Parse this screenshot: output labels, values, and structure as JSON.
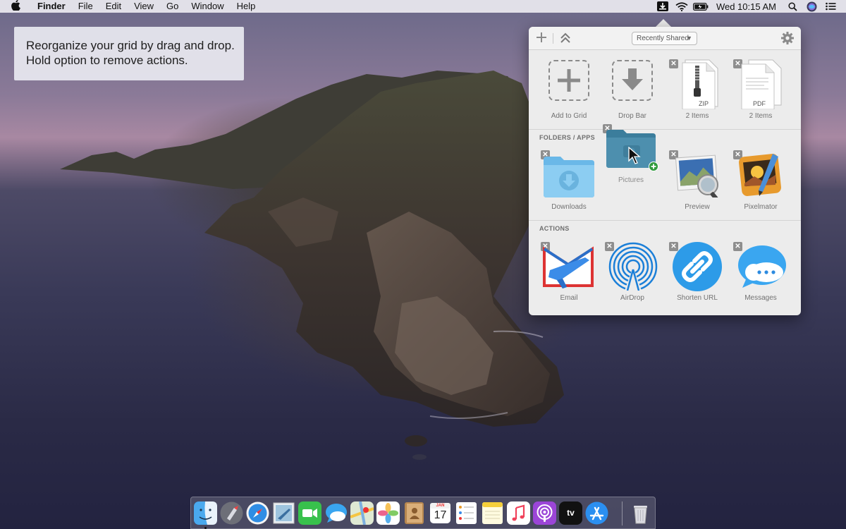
{
  "menubar": {
    "app_name": "Finder",
    "menus": [
      "File",
      "Edit",
      "View",
      "Go",
      "Window",
      "Help"
    ],
    "clock": "Wed 10:15 AM",
    "status_icons": [
      "dropzone-icon",
      "wifi-icon",
      "battery-icon",
      "search-icon",
      "siri-icon",
      "control-center-icon"
    ]
  },
  "callout": {
    "line1": "Reorganize your grid by drag and drop.",
    "line2": "Hold option to remove actions."
  },
  "panel": {
    "toolbar": {
      "filter_value": "Recently Shared",
      "icons": [
        "add-icon",
        "collapse-icon",
        "gear-icon"
      ]
    },
    "top_row": [
      {
        "label": "Add to Grid",
        "icon": "add-icon"
      },
      {
        "label": "Drop Bar",
        "icon": "download-arrow-icon"
      },
      {
        "label": "2 Items",
        "icon": "zip-file-icon",
        "badge": "ZIP"
      },
      {
        "label": "2 Items",
        "icon": "pdf-file-icon",
        "badge": "PDF"
      }
    ],
    "folders_section": {
      "title": "FOLDERS / APPS",
      "items": [
        {
          "label": "Downloads",
          "icon": "downloads-folder-icon"
        },
        {
          "label": "Pictures",
          "icon": "pictures-folder-icon"
        },
        {
          "label": "Preview",
          "icon": "preview-app-icon"
        },
        {
          "label": "Pixelmator",
          "icon": "pixelmator-app-icon"
        }
      ]
    },
    "actions_section": {
      "title": "ACTIONS",
      "items": [
        {
          "label": "Email",
          "icon": "email-icon"
        },
        {
          "label": "AirDrop",
          "icon": "airdrop-icon"
        },
        {
          "label": "Shorten URL",
          "icon": "link-icon"
        },
        {
          "label": "Messages",
          "icon": "messages-icon"
        }
      ]
    }
  },
  "dock": {
    "apps": [
      "Finder",
      "Launchpad",
      "Safari",
      "Mail",
      "FaceTime",
      "Messages",
      "Maps",
      "Photos",
      "Contacts",
      "Calendar",
      "Reminders",
      "Notes",
      "Music",
      "Podcasts",
      "TV",
      "App Store",
      "Trash"
    ],
    "calendar_month": "JAN",
    "calendar_day": "17",
    "tv_label": "tv"
  }
}
